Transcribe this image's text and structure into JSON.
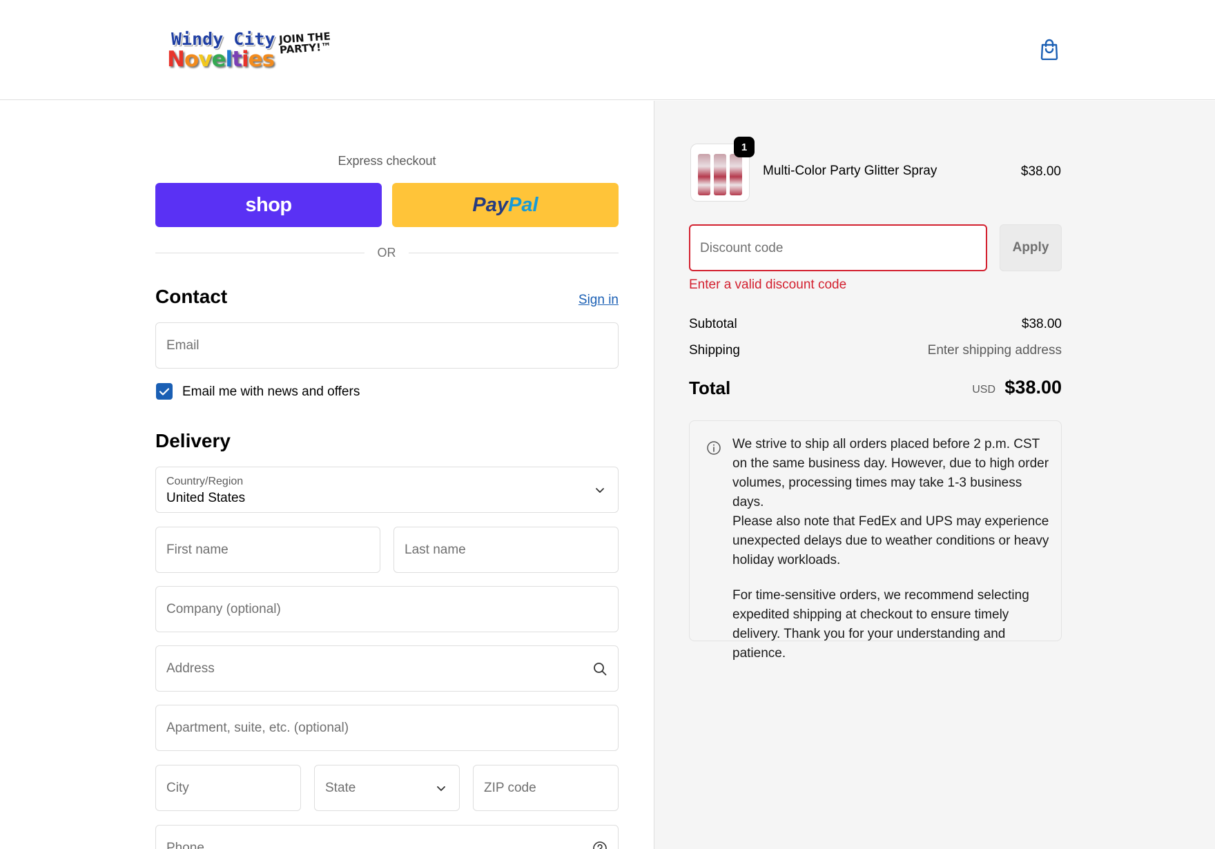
{
  "header": {
    "logo_line1": "Windy City",
    "logo_line2": [
      "N",
      "o",
      "v",
      "e",
      "l",
      "t",
      "i",
      "es"
    ],
    "logo_tagline": "JOIN THE PARTY!™",
    "cart_icon": "shopping-bag-icon"
  },
  "express": {
    "title": "Express checkout",
    "shop_label": "shop",
    "paypal_label_1": "Pay",
    "paypal_label_2": "Pal",
    "or_label": "OR"
  },
  "contact": {
    "heading": "Contact",
    "sign_in": "Sign in",
    "email_placeholder": "Email",
    "news_checkbox_label": "Email me with news and offers",
    "news_checked": true
  },
  "delivery": {
    "heading": "Delivery",
    "country_label": "Country/Region",
    "country_value": "United States",
    "first_name": "First name",
    "last_name": "Last name",
    "company": "Company (optional)",
    "address": "Address",
    "apartment": "Apartment, suite, etc. (optional)",
    "city": "City",
    "state": "State",
    "zip": "ZIP code",
    "phone": "Phone"
  },
  "summary": {
    "item": {
      "name": "Multi-Color Party Glitter Spray",
      "price": "$38.00",
      "quantity": "1"
    },
    "discount_placeholder": "Discount code",
    "apply_label": "Apply",
    "discount_error": "Enter a valid discount code",
    "subtotal_label": "Subtotal",
    "subtotal_value": "$38.00",
    "shipping_label": "Shipping",
    "shipping_value": "Enter shipping address",
    "total_label": "Total",
    "total_currency": "USD",
    "total_value": "$38.00",
    "note_p1": "We strive to ship all orders placed before 2 p.m. CST on the same business day. However, due to high order volumes, processing times may take 1-3 business days.",
    "note_p2": "Please also note that FedEx and UPS may experience unexpected delays due to weather conditions or heavy holiday workloads.",
    "note_p3": "For time-sensitive orders, we recommend selecting expedited shipping at checkout to ensure timely delivery. Thank you for your understanding and patience."
  },
  "colors": {
    "shop": "#5a31f4",
    "paypal": "#ffc439",
    "link": "#1a5fb4",
    "error": "#d3202f"
  }
}
